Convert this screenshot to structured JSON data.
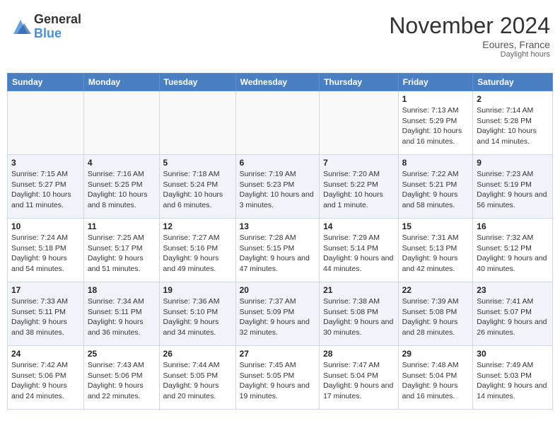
{
  "logo": {
    "general": "General",
    "blue": "Blue"
  },
  "title": {
    "month": "November 2024",
    "location": "Eoures, France",
    "daylight_note": "Daylight hours"
  },
  "calendar": {
    "headers": [
      "Sunday",
      "Monday",
      "Tuesday",
      "Wednesday",
      "Thursday",
      "Friday",
      "Saturday"
    ],
    "weeks": [
      [
        {
          "day": "",
          "info": ""
        },
        {
          "day": "",
          "info": ""
        },
        {
          "day": "",
          "info": ""
        },
        {
          "day": "",
          "info": ""
        },
        {
          "day": "",
          "info": ""
        },
        {
          "day": "1",
          "info": "Sunrise: 7:13 AM\nSunset: 5:29 PM\nDaylight: 10 hours and 16 minutes."
        },
        {
          "day": "2",
          "info": "Sunrise: 7:14 AM\nSunset: 5:28 PM\nDaylight: 10 hours and 14 minutes."
        }
      ],
      [
        {
          "day": "3",
          "info": "Sunrise: 7:15 AM\nSunset: 5:27 PM\nDaylight: 10 hours and 11 minutes."
        },
        {
          "day": "4",
          "info": "Sunrise: 7:16 AM\nSunset: 5:25 PM\nDaylight: 10 hours and 8 minutes."
        },
        {
          "day": "5",
          "info": "Sunrise: 7:18 AM\nSunset: 5:24 PM\nDaylight: 10 hours and 6 minutes."
        },
        {
          "day": "6",
          "info": "Sunrise: 7:19 AM\nSunset: 5:23 PM\nDaylight: 10 hours and 3 minutes."
        },
        {
          "day": "7",
          "info": "Sunrise: 7:20 AM\nSunset: 5:22 PM\nDaylight: 10 hours and 1 minute."
        },
        {
          "day": "8",
          "info": "Sunrise: 7:22 AM\nSunset: 5:21 PM\nDaylight: 9 hours and 58 minutes."
        },
        {
          "day": "9",
          "info": "Sunrise: 7:23 AM\nSunset: 5:19 PM\nDaylight: 9 hours and 56 minutes."
        }
      ],
      [
        {
          "day": "10",
          "info": "Sunrise: 7:24 AM\nSunset: 5:18 PM\nDaylight: 9 hours and 54 minutes."
        },
        {
          "day": "11",
          "info": "Sunrise: 7:25 AM\nSunset: 5:17 PM\nDaylight: 9 hours and 51 minutes."
        },
        {
          "day": "12",
          "info": "Sunrise: 7:27 AM\nSunset: 5:16 PM\nDaylight: 9 hours and 49 minutes."
        },
        {
          "day": "13",
          "info": "Sunrise: 7:28 AM\nSunset: 5:15 PM\nDaylight: 9 hours and 47 minutes."
        },
        {
          "day": "14",
          "info": "Sunrise: 7:29 AM\nSunset: 5:14 PM\nDaylight: 9 hours and 44 minutes."
        },
        {
          "day": "15",
          "info": "Sunrise: 7:31 AM\nSunset: 5:13 PM\nDaylight: 9 hours and 42 minutes."
        },
        {
          "day": "16",
          "info": "Sunrise: 7:32 AM\nSunset: 5:12 PM\nDaylight: 9 hours and 40 minutes."
        }
      ],
      [
        {
          "day": "17",
          "info": "Sunrise: 7:33 AM\nSunset: 5:11 PM\nDaylight: 9 hours and 38 minutes."
        },
        {
          "day": "18",
          "info": "Sunrise: 7:34 AM\nSunset: 5:11 PM\nDaylight: 9 hours and 36 minutes."
        },
        {
          "day": "19",
          "info": "Sunrise: 7:36 AM\nSunset: 5:10 PM\nDaylight: 9 hours and 34 minutes."
        },
        {
          "day": "20",
          "info": "Sunrise: 7:37 AM\nSunset: 5:09 PM\nDaylight: 9 hours and 32 minutes."
        },
        {
          "day": "21",
          "info": "Sunrise: 7:38 AM\nSunset: 5:08 PM\nDaylight: 9 hours and 30 minutes."
        },
        {
          "day": "22",
          "info": "Sunrise: 7:39 AM\nSunset: 5:08 PM\nDaylight: 9 hours and 28 minutes."
        },
        {
          "day": "23",
          "info": "Sunrise: 7:41 AM\nSunset: 5:07 PM\nDaylight: 9 hours and 26 minutes."
        }
      ],
      [
        {
          "day": "24",
          "info": "Sunrise: 7:42 AM\nSunset: 5:06 PM\nDaylight: 9 hours and 24 minutes."
        },
        {
          "day": "25",
          "info": "Sunrise: 7:43 AM\nSunset: 5:06 PM\nDaylight: 9 hours and 22 minutes."
        },
        {
          "day": "26",
          "info": "Sunrise: 7:44 AM\nSunset: 5:05 PM\nDaylight: 9 hours and 20 minutes."
        },
        {
          "day": "27",
          "info": "Sunrise: 7:45 AM\nSunset: 5:05 PM\nDaylight: 9 hours and 19 minutes."
        },
        {
          "day": "28",
          "info": "Sunrise: 7:47 AM\nSunset: 5:04 PM\nDaylight: 9 hours and 17 minutes."
        },
        {
          "day": "29",
          "info": "Sunrise: 7:48 AM\nSunset: 5:04 PM\nDaylight: 9 hours and 16 minutes."
        },
        {
          "day": "30",
          "info": "Sunrise: 7:49 AM\nSunset: 5:03 PM\nDaylight: 9 hours and 14 minutes."
        }
      ]
    ]
  }
}
